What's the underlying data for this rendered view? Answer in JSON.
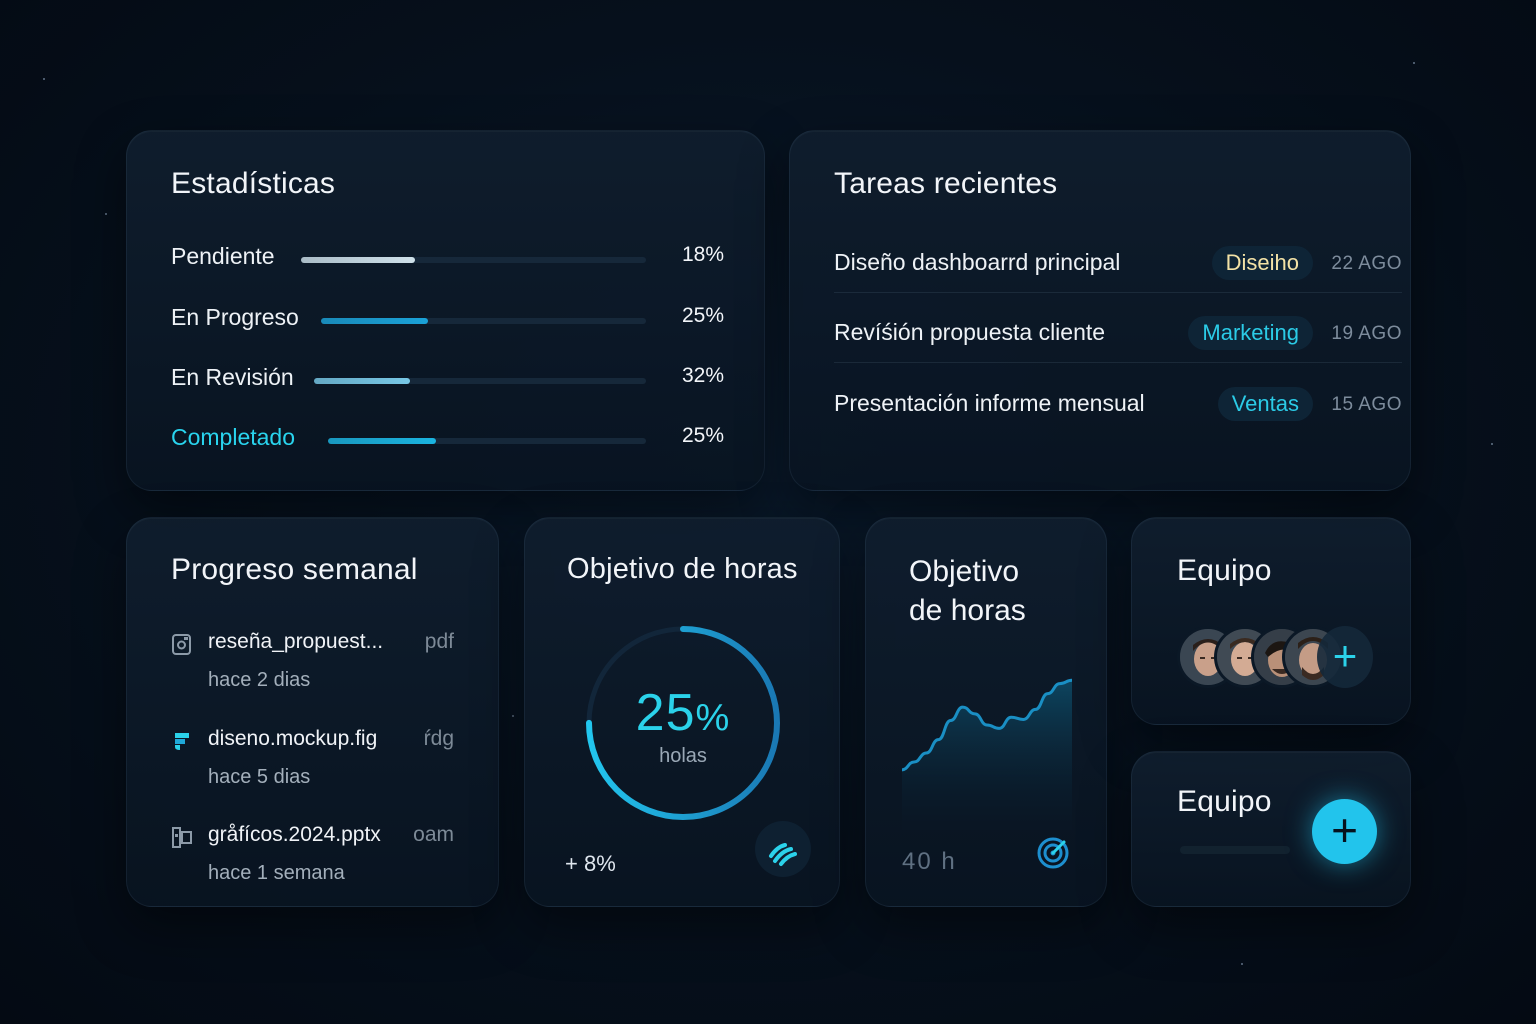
{
  "stats": {
    "title": "Estadísticas",
    "items": [
      {
        "label": "Pendiente",
        "value": "18%",
        "fill": 0.33,
        "color": "#cfe1ea",
        "accent": false
      },
      {
        "label": "En Progreso",
        "value": "25%",
        "fill": 0.33,
        "color": "#1aa2d8",
        "accent": false
      },
      {
        "label": "En Revisión",
        "value": "32%",
        "fill": 0.29,
        "color": "#78c8e6",
        "accent": false
      },
      {
        "label": "Completado",
        "value": "25%",
        "fill": 0.34,
        "color": "#1ab4e0",
        "accent": true
      }
    ]
  },
  "tasks": {
    "title": "Tareas recientes",
    "items": [
      {
        "name": "Diseño dashboarrd principal",
        "tag": "Diseiho",
        "tag_color": "#f3e2a6",
        "date": "22 AGO"
      },
      {
        "name": "Revíśión propuesta cliente",
        "tag": "Marketing",
        "tag_color": "#2bcbe6",
        "date": "19 AGO"
      },
      {
        "name": "Presentación informe mensual",
        "tag": "Ventas",
        "tag_color": "#2bcbe6",
        "date": "15 AGO"
      }
    ]
  },
  "weekly": {
    "title": "Progreso semanal",
    "files": [
      {
        "name": "reseña_propuest...",
        "ext": "pdf",
        "time": "hace 2 dias",
        "icon": "image-file-icon"
      },
      {
        "name": "diseno.mockup.fig",
        "ext": "ŕdg",
        "time": "hace 5 dias",
        "icon": "figma-icon"
      },
      {
        "name": "gråfícos.2024.pptx",
        "ext": "oam",
        "time": "hace 1 semana",
        "icon": "presentation-icon"
      }
    ]
  },
  "goal_ring": {
    "title": "Objetivo de horas",
    "value": "25",
    "value_unit": "%",
    "unit": "holas",
    "delta": "+ 8%",
    "progress": 0.75,
    "icon": "signal-icon"
  },
  "goal_area": {
    "title_line1": "Objetivo",
    "title_line2": "de horas",
    "value": "40 h",
    "icon": "target-icon",
    "chart_data": {
      "type": "area",
      "values": [
        0.18,
        0.25,
        0.33,
        0.45,
        0.62,
        0.74,
        0.68,
        0.58,
        0.55,
        0.65,
        0.63,
        0.72,
        0.86,
        0.95,
        0.98
      ]
    }
  },
  "team": {
    "title": "Equipo",
    "avatars": [
      "avatar-1",
      "avatar-2",
      "avatar-3",
      "avatar-4"
    ],
    "add_label": "+"
  },
  "team2": {
    "title": "Equipo",
    "add_label": "+"
  },
  "colors": {
    "accent": "#2bd2ea",
    "background": "#06101c"
  }
}
